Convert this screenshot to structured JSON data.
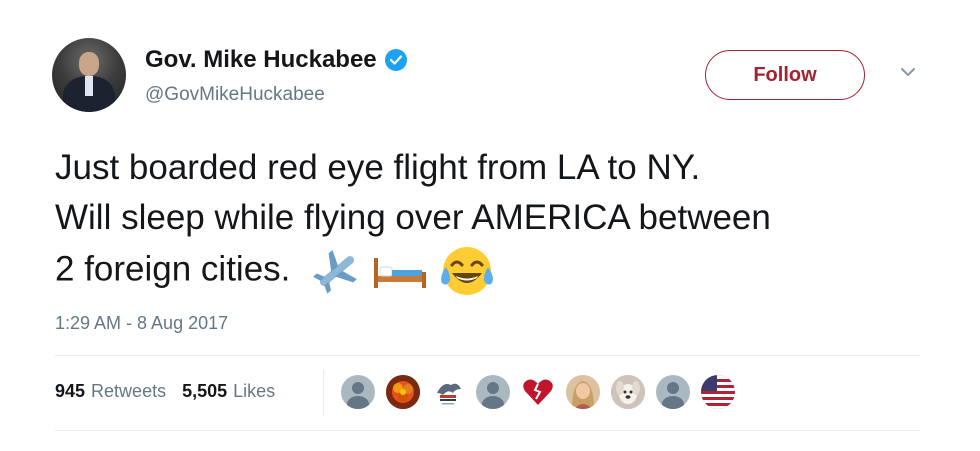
{
  "author": {
    "display_name": "Gov. Mike Huckabee",
    "handle": "@GovMikeHuckabee",
    "verified": true
  },
  "follow_button": {
    "label": "Follow",
    "color": "#a3222f"
  },
  "tweet": {
    "lines": [
      "Just boarded red eye flight from LA to NY.",
      "Will sleep while flying over AMERICA between",
      "2 foreign cities."
    ],
    "emojis": [
      "airplane-emoji",
      "bed-emoji",
      "tears-of-joy-emoji"
    ]
  },
  "timestamp": "1:29 AM - 8 Aug 2017",
  "stats": {
    "retweets": {
      "count": "945",
      "label": "Retweets"
    },
    "likes": {
      "count": "5,505",
      "label": "Likes"
    }
  },
  "likers": [
    "default-avatar",
    "flower-avatar",
    "eagle-logo-avatar",
    "default-avatar",
    "heart-avatar",
    "woman-avatar",
    "dog-avatar",
    "default-avatar",
    "flag-avatar"
  ],
  "colors": {
    "text": "#14171a",
    "secondary": "#657786",
    "verified": "#1da1f2",
    "divider": "#e6ecf0"
  }
}
